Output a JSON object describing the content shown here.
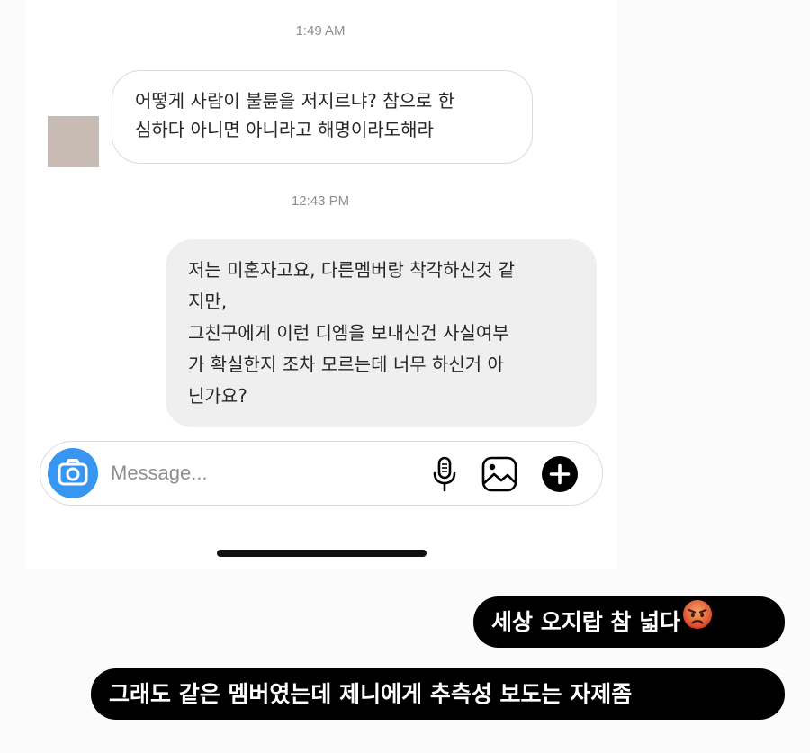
{
  "chat": {
    "timestamps": [
      "1:49 AM",
      "12:43 PM"
    ],
    "incoming_message": {
      "lines": [
        "어떻게 사람이 불륜을 저지르냐? 참으로 한",
        "심하다 아니면 아니라고 해명이라도해라"
      ]
    },
    "outgoing_message": {
      "lines": [
        "저는 미혼자고요, 다른멤버랑 착각하신것 같",
        "지만,",
        "그친구에게 이런 디엠을 보내신건 사실여부",
        "가 확실한지 조차 모르는데 너무 하신거 아",
        "닌가요?"
      ]
    }
  },
  "composer": {
    "placeholder": "Message...",
    "value": "",
    "icons": {
      "camera": "camera-icon",
      "mic": "microphone-icon",
      "gallery": "image-gallery-icon",
      "plus": "plus-circle-icon"
    }
  },
  "captions": {
    "first": "세상 오지랍 참 넓다",
    "first_emoji": "angry-face-emoji",
    "second": "그래도 같은 멤버였는데 제니에게 추측성 보도는 자제좀"
  },
  "colors": {
    "accent_blue": "#3797f0",
    "outgoing_bubble": "#efefef",
    "caption_bg": "#000000",
    "emoji_red": "#e0472f"
  }
}
